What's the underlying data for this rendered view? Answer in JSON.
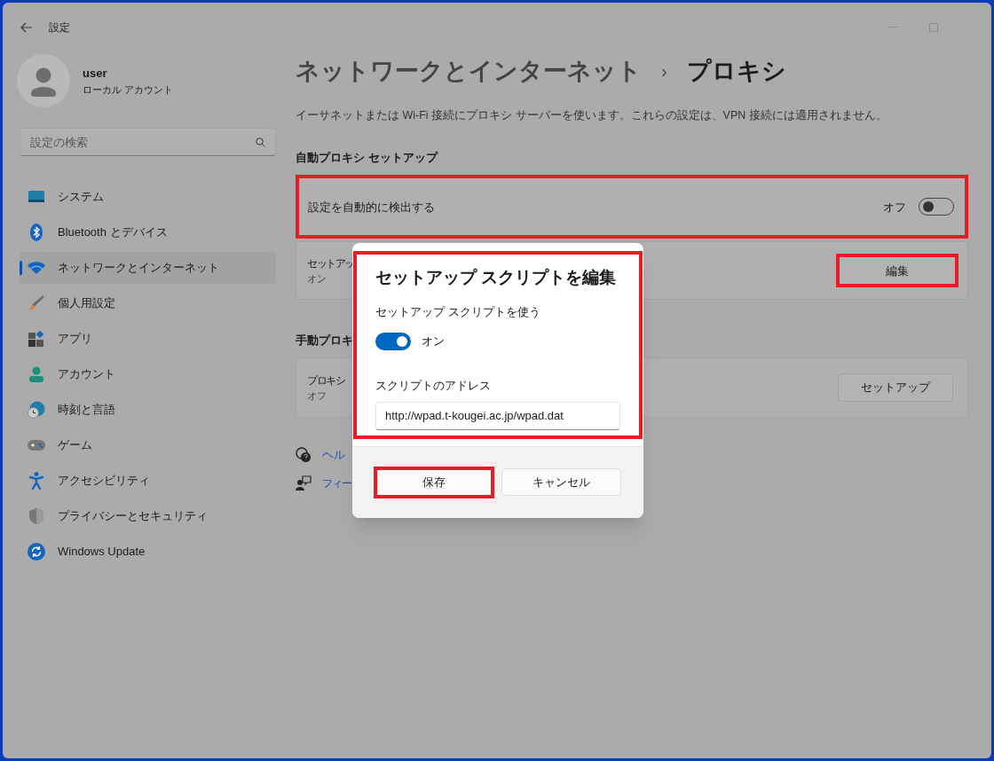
{
  "window": {
    "title": "設定"
  },
  "user": {
    "name": "user",
    "account": "ローカル アカウント"
  },
  "search": {
    "placeholder": "設定の検索"
  },
  "nav": [
    {
      "label": "システム",
      "selected": false
    },
    {
      "label": "Bluetooth とデバイス",
      "selected": false
    },
    {
      "label": "ネットワークとインターネット",
      "selected": true
    },
    {
      "label": "個人用設定",
      "selected": false
    },
    {
      "label": "アプリ",
      "selected": false
    },
    {
      "label": "アカウント",
      "selected": false
    },
    {
      "label": "時刻と言語",
      "selected": false
    },
    {
      "label": "ゲーム",
      "selected": false
    },
    {
      "label": "アクセシビリティ",
      "selected": false
    },
    {
      "label": "プライバシーとセキュリティ",
      "selected": false
    },
    {
      "label": "Windows Update",
      "selected": false
    }
  ],
  "breadcrumb": {
    "parent": "ネットワークとインターネット",
    "separator": "›",
    "current": "プロキシ"
  },
  "description": "イーサネットまたは Wi-Fi 接続にプロキシ サーバーを使います。これらの設定は、VPN 接続には適用されません。",
  "auto_section": {
    "heading": "自動プロキシ セットアップ",
    "detect_row": {
      "label": "設定を自動的に検出する",
      "state_text": "オフ",
      "on": false
    },
    "script_row": {
      "label": "セットアッ",
      "sub": "オン",
      "button": "編集"
    }
  },
  "manual_section": {
    "heading": "手動プロキ",
    "proxy_row": {
      "label": "プロキシ",
      "sub": "オフ",
      "button": "セットアップ"
    }
  },
  "links": [
    "ヘル",
    "フィー"
  ],
  "dialog": {
    "title": "セットアップ スクリプトを編集",
    "toggle_label": "セットアップ スクリプトを使う",
    "toggle": {
      "on": true,
      "state_text": "オン"
    },
    "address_label": "スクリプトのアドレス",
    "address_value": "http://wpad.t-kougei.ac.jp/wpad.dat",
    "buttons": [
      "保存",
      "キャンセル"
    ]
  }
}
